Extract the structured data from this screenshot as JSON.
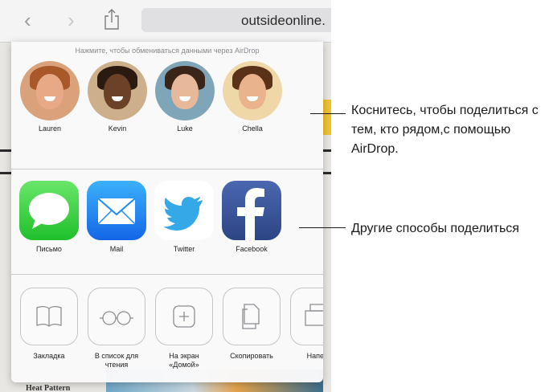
{
  "browser": {
    "url_text": "outsideonline.",
    "back_icon": "chevron-left-icon",
    "forward_icon": "chevron-right-icon",
    "share_icon": "share-icon"
  },
  "share_sheet": {
    "airdrop_hint": "Нажмите, чтобы обмениваться данными через AirDrop",
    "people": [
      {
        "name": "Lauren",
        "skin": "#e8a987",
        "hair": "#a9582a",
        "bg": "#d9a27a"
      },
      {
        "name": "Kevin",
        "skin": "#6b4128",
        "hair": "#2a1a10",
        "bg": "#cdb08b"
      },
      {
        "name": "Luke",
        "skin": "#e7b899",
        "hair": "#3a2618",
        "bg": "#7fa6b8"
      },
      {
        "name": "Chella",
        "skin": "#e9b38e",
        "hair": "#5a3218",
        "bg": "#f0d7a8"
      }
    ],
    "apps": [
      {
        "label": "Письмо",
        "icon": "messages-icon",
        "color": "#4cd964"
      },
      {
        "label": "Mail",
        "icon": "mail-icon",
        "color": "#1d8cf5"
      },
      {
        "label": "Twitter",
        "icon": "twitter-icon",
        "color": "#ffffff"
      },
      {
        "label": "Facebook",
        "icon": "facebook-icon",
        "color": "#3b5998"
      }
    ],
    "actions": [
      {
        "label": "Закладка",
        "icon": "bookmark-icon"
      },
      {
        "label": "В список для\nчтения",
        "icon": "reading-list-icon"
      },
      {
        "label": "На экран\n«Домой»",
        "icon": "add-to-home-icon"
      },
      {
        "label": "Скопировать",
        "icon": "copy-icon"
      },
      {
        "label": "Напеча",
        "icon": "print-icon"
      }
    ]
  },
  "callouts": {
    "airdrop": "Коснитесь, чтобы поделиться с тем, кто рядом,с помощью AirDrop.",
    "other": "Другие способы поделиться"
  },
  "colors": {
    "accent_blue": "#1d8cf5",
    "messages_green": "#4cd964",
    "facebook_blue": "#3b5998"
  }
}
